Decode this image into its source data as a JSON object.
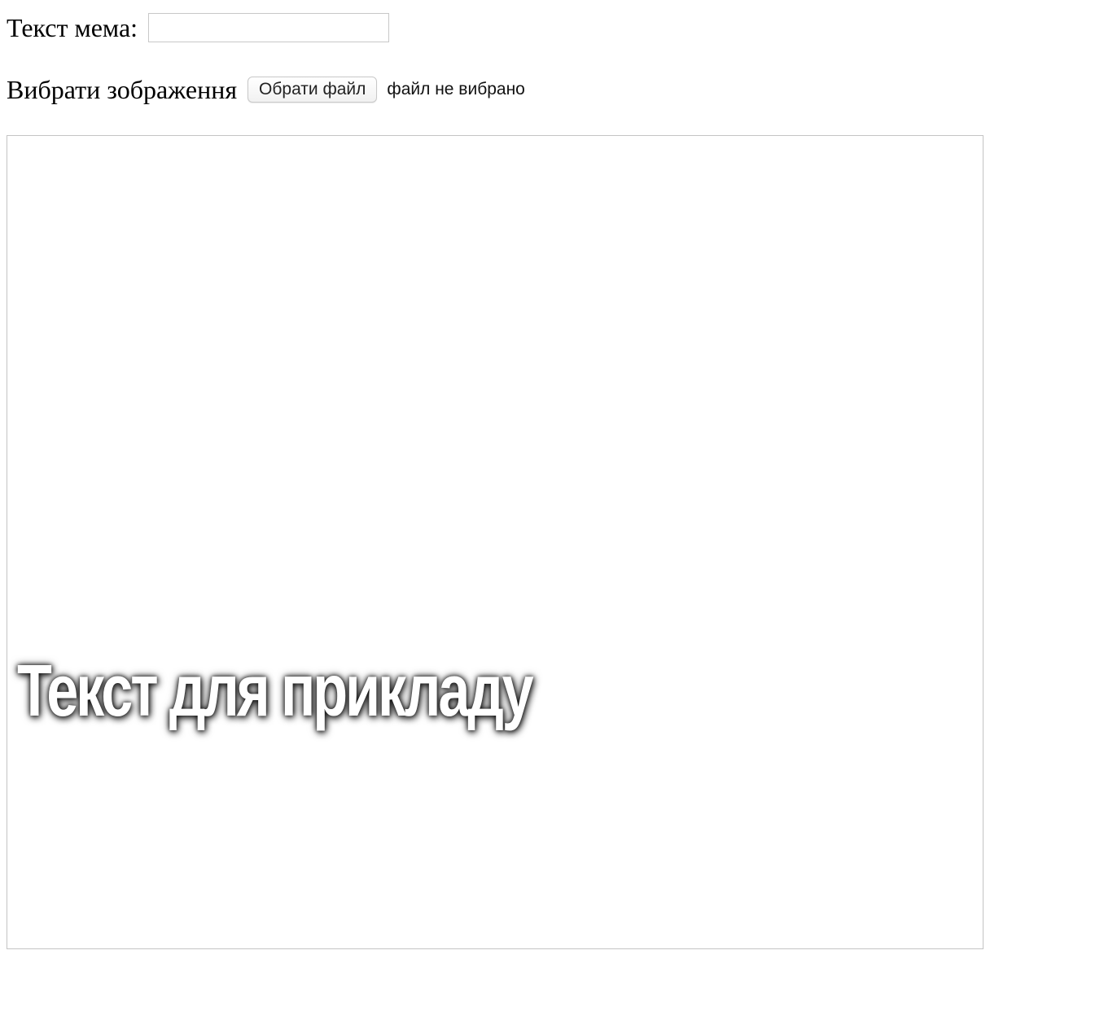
{
  "form": {
    "meme_text_label": "Текст мема:",
    "meme_text_value": "",
    "image_label": "Вибрати зображення",
    "file_button_label": "Обрати файл",
    "file_status": "файл не вибрано"
  },
  "canvas": {
    "caption": "Текст для прикладу",
    "caption_color": "#ffffff",
    "background_color": "#ffffff"
  }
}
